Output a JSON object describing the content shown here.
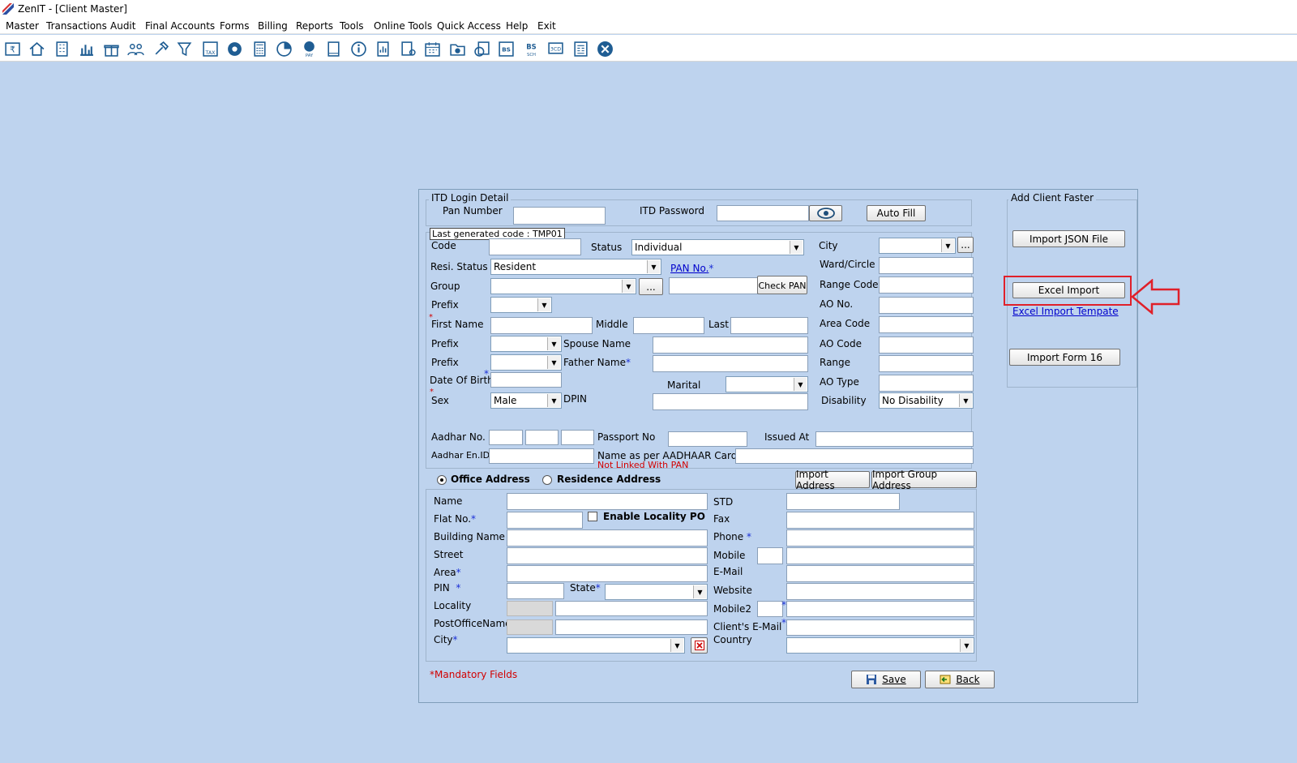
{
  "window": {
    "title": "ZenIT - [Client Master]"
  },
  "menu": [
    "Master",
    "Transactions",
    "Audit",
    "Final Accounts",
    "Forms",
    "Billing",
    "Reports",
    "Tools",
    "Online Tools",
    "Quick Access",
    "Help",
    "Exit"
  ],
  "toolbar_icons": [
    "rupee-book-icon",
    "home-icon",
    "building-icon",
    "bar-chart-icon",
    "gift-icon",
    "people-icon",
    "hammer-icon",
    "filter-icon",
    "tax-icon",
    "disc-icon",
    "calculator-icon",
    "pie-chart-icon",
    "pay-icon",
    "book-icon",
    "info-icon",
    "report-icon",
    "document-user-icon",
    "calendar-icon",
    "folder-add-icon",
    "refresh-doc-icon",
    "bs-icon",
    "bs-sch-icon",
    "3cd-icon",
    "form-icon",
    "close-circle-icon"
  ],
  "itd": {
    "legend": "ITD Login Detail",
    "pan_label": "Pan Number",
    "password_label": "ITD Password",
    "auto_fill": "Auto Fill"
  },
  "faster": {
    "legend": "Add Client Faster",
    "json_btn": "Import JSON File",
    "excel_btn": "Excel Import",
    "excel_template": "Excel Import Tempate",
    "form16_btn": "Import Form 16"
  },
  "client": {
    "last_code": "Last generated code : TMP01",
    "code_label": "Code",
    "status_label": "Status",
    "status_value": "Individual",
    "city_label": "City",
    "resi_label": "Resi. Status",
    "resi_value": "Resident",
    "pan_label": "PAN No.",
    "ward_label": "Ward/Circle",
    "group_label": "Group",
    "check_pan": "Check PAN",
    "range_code_label": "Range Code",
    "prefix_label": "Prefix",
    "ao_no_label": "AO No.",
    "first_name_label": "First Name",
    "middle_label": "Middle",
    "last_label": "Last",
    "area_code_label": "Area Code",
    "spouse_label": "Spouse Name",
    "ao_code_label": "AO Code",
    "father_label": "Father Name",
    "range_label": "Range",
    "dob_label": "Date Of Birth",
    "marital_label": "Marital",
    "ao_type_label": "AO Type",
    "sex_label": "Sex",
    "sex_value": "Male",
    "dpin_label": "DPIN",
    "disability_label": "Disability",
    "disability_value": "No Disability",
    "aadhar_label": "Aadhar No.",
    "passport_label": "Passport No",
    "issued_label": "Issued At",
    "aadhar_en_label": "Aadhar En.ID",
    "aadhar_name_label": "Name as per AADHAAR Card",
    "not_linked": "Not Linked With PAN"
  },
  "address": {
    "office": "Office Address",
    "residence": "Residence Address",
    "import_address": "Import Address",
    "import_group": "Import Group Address",
    "name": "Name",
    "std": "STD",
    "flat": "Flat No.",
    "enable_locality": "Enable Locality PO",
    "fax": "Fax",
    "building": "Building Name",
    "phone": "Phone",
    "street": "Street",
    "mobile": "Mobile",
    "area": "Area",
    "email": "E-Mail",
    "pin": "PIN",
    "state": "State",
    "website": "Website",
    "locality": "Locality",
    "mobile2": "Mobile2",
    "post_office": "PostOfficeName",
    "client_email": "Client's E-Mail",
    "city": "City",
    "country": "Country"
  },
  "footer": {
    "mandatory": "*Mandatory Fields",
    "save": "Save",
    "back": "Back"
  },
  "colors": {
    "background": "#bed3ee",
    "highlight": "#e0202a",
    "link": "#0000cc",
    "mandatory": "#d20000"
  }
}
